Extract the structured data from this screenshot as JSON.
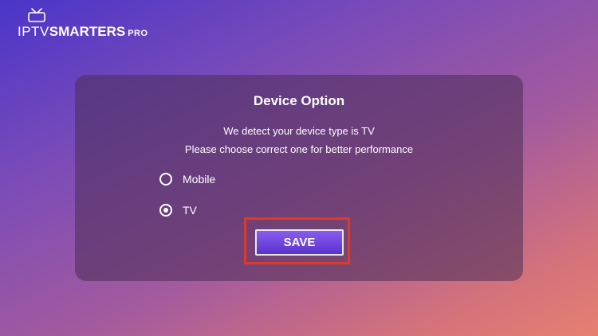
{
  "app": {
    "logo": {
      "prefix": "IPTV",
      "name": "SMARTERS",
      "suffix": "PRO",
      "icon": "tv-antenna-icon"
    }
  },
  "dialog": {
    "title": "Device Option",
    "message_line1": "We detect your device type is TV",
    "message_line2": "Please choose correct one for better performance",
    "options": [
      {
        "label": "Mobile",
        "selected": false
      },
      {
        "label": "TV",
        "selected": true
      }
    ],
    "save_label": "SAVE",
    "highlight_color": "#e23a22"
  }
}
